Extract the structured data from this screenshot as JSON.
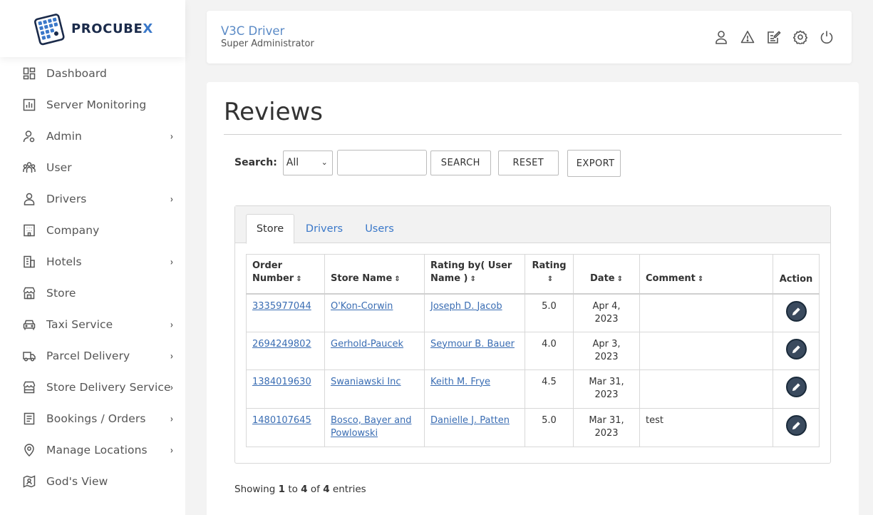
{
  "brand": {
    "name_a": "PROCUBE",
    "name_b": "X"
  },
  "sidebar": {
    "items": [
      {
        "label": "Dashboard",
        "icon": "dashboard-icon",
        "has_children": false
      },
      {
        "label": "Server Monitoring",
        "icon": "chart-icon",
        "has_children": false
      },
      {
        "label": "Admin",
        "icon": "admin-icon",
        "has_children": true
      },
      {
        "label": "User",
        "icon": "users-icon",
        "has_children": false
      },
      {
        "label": "Drivers",
        "icon": "driver-icon",
        "has_children": true
      },
      {
        "label": "Company",
        "icon": "building-icon",
        "has_children": false
      },
      {
        "label": "Hotels",
        "icon": "hotel-icon",
        "has_children": true
      },
      {
        "label": "Store",
        "icon": "store-icon",
        "has_children": false
      },
      {
        "label": "Taxi Service",
        "icon": "taxi-icon",
        "has_children": true
      },
      {
        "label": "Parcel Delivery",
        "icon": "truck-icon",
        "has_children": true
      },
      {
        "label": "Store Delivery Service",
        "icon": "store-delivery-icon",
        "has_children": true
      },
      {
        "label": "Bookings / Orders",
        "icon": "orders-icon",
        "has_children": true
      },
      {
        "label": "Manage Locations",
        "icon": "location-icon",
        "has_children": true
      },
      {
        "label": "God's View",
        "icon": "map-user-icon",
        "has_children": false
      }
    ],
    "chevron": "›"
  },
  "header": {
    "title": "V3C Driver",
    "subtitle": "Super Administrator",
    "icons": [
      "profile-icon",
      "alert-icon",
      "notes-icon",
      "settings-icon",
      "power-icon"
    ]
  },
  "main": {
    "title": "Reviews",
    "search": {
      "label": "Search:",
      "select_value": "All",
      "input_value": "",
      "search_label": "SEARCH",
      "reset_label": "RESET",
      "export_label": "EXPORT"
    },
    "tabs": [
      {
        "label": "Store",
        "active": true
      },
      {
        "label": "Drivers",
        "active": false
      },
      {
        "label": "Users",
        "active": false
      }
    ],
    "table": {
      "headers": {
        "order_a": "Order",
        "order_b": "Number",
        "store": "Store Name",
        "rating_by_a": "Rating by( User",
        "rating_by_b": "Name )",
        "rating": "Rating",
        "date": "Date",
        "comment": "Comment",
        "action": "Action"
      },
      "rows": [
        {
          "order": "3335977044",
          "store": "O'Kon-Corwin",
          "user": "Joseph D. Jacob",
          "rating": "5.0",
          "date": "Apr 4, 2023",
          "comment": ""
        },
        {
          "order": "2694249802",
          "store": "Gerhold-Paucek",
          "user": "Seymour B. Bauer",
          "rating": "4.0",
          "date": "Apr 3, 2023",
          "comment": ""
        },
        {
          "order": "1384019630",
          "store": "Swaniawski Inc",
          "user": "Keith M. Frye",
          "rating": "4.5",
          "date": "Mar 31, 2023",
          "comment": ""
        },
        {
          "order": "1480107645",
          "store": "Bosco, Bayer and Powlowski",
          "user": "Danielle J. Patten",
          "rating": "5.0",
          "date": "Mar 31, 2023",
          "comment": "test"
        }
      ]
    },
    "footer": {
      "prefix": "Showing",
      "from": "1",
      "to_word": "to",
      "to": "4",
      "of_word": "of",
      "total": "4",
      "suffix": "entries"
    }
  },
  "colors": {
    "accent": "#3a78c9",
    "link": "#3a6db3",
    "brand_dark": "#1a2a4a"
  }
}
